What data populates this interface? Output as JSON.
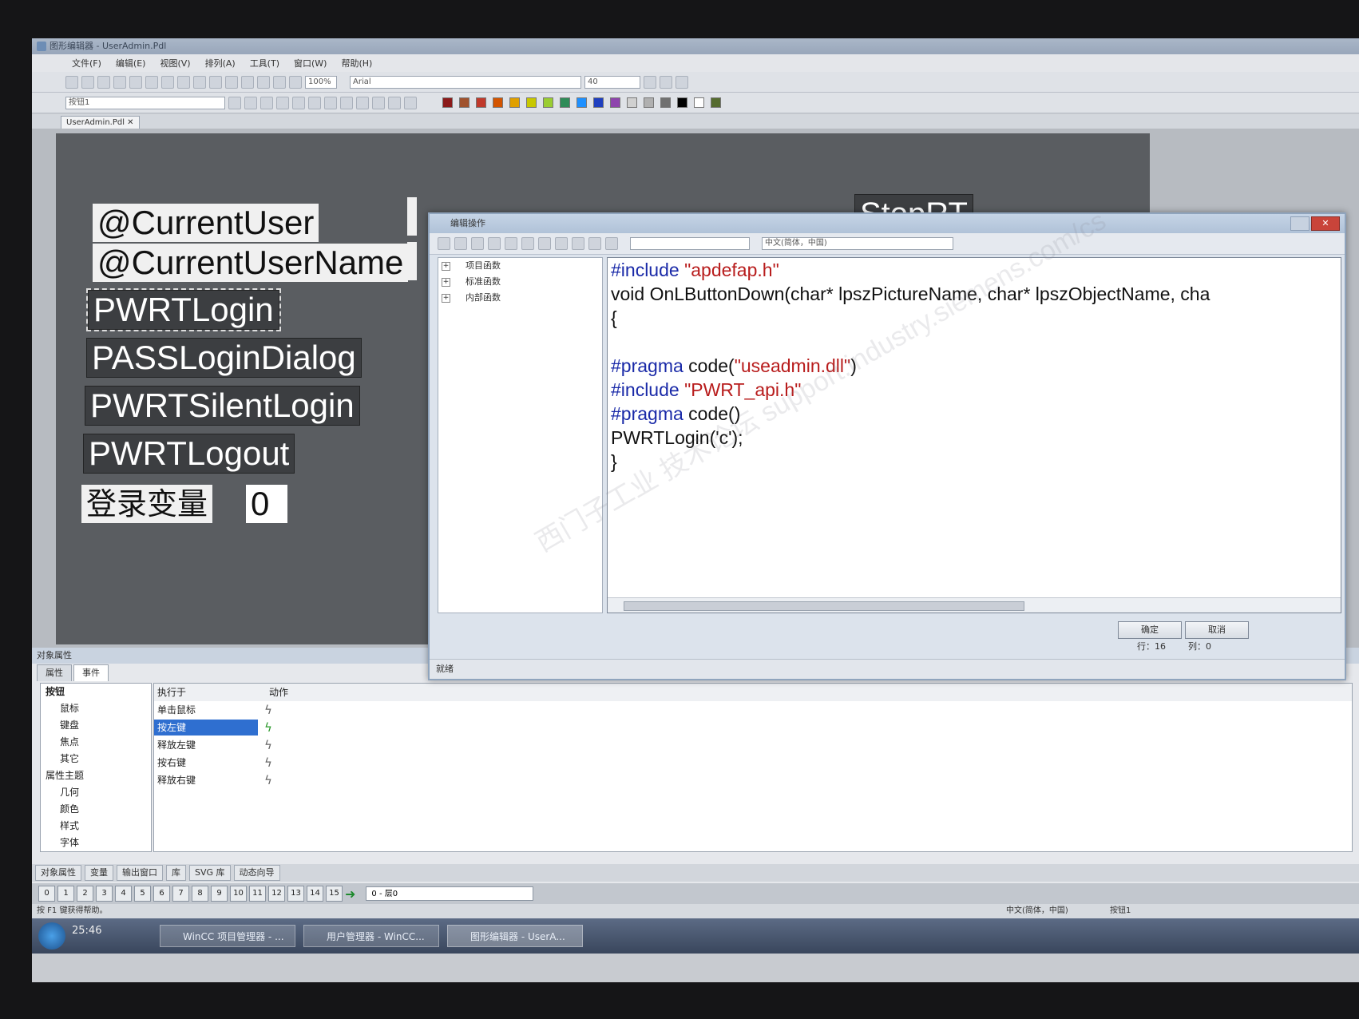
{
  "window": {
    "title": "图形编辑器 - UserAdmin.Pdl"
  },
  "menu": [
    "文件(F)",
    "编辑(E)",
    "视图(V)",
    "排列(A)",
    "工具(T)",
    "窗口(W)",
    "帮助(H)"
  ],
  "toolbar": {
    "zoom": "100%",
    "font": "Arial",
    "font_size": "40",
    "object_combo": "按钮1"
  },
  "colors_palette": [
    "#8b1a1a",
    "#a0522d",
    "#c0392b",
    "#d35400",
    "#e0a000",
    "#c8c800",
    "#9acd32",
    "#2e8b57",
    "#1e90ff",
    "#1f3fbf",
    "#8e44ad",
    "#d0d0d0",
    "#b0b0b0",
    "#707070",
    "#000000",
    "#ffffff",
    "#556b2f"
  ],
  "doc_tab": "UserAdmin.Pdl",
  "canvas_objects": {
    "current_user": "@CurrentUser",
    "current_user_name": "@CurrentUserName",
    "pwrt_login": "PWRTLogin",
    "pass_login_dialog": "PASSLoginDialog",
    "pwrt_silent_login": "PWRTSilentLogin",
    "pwrt_logout": "PWRTLogout",
    "login_var_label": "登录变量",
    "login_var_value": "0",
    "stop_rt": "StopRT"
  },
  "dialog": {
    "title": "编辑操作",
    "lang": "中文(简体，中国)",
    "tree": [
      "项目函数",
      "标准函数",
      "内部函数"
    ],
    "code": {
      "l1_kw": "#include",
      "l1_str": "\"apdefap.h\"",
      "l2": "void OnLButtonDown(char* lpszPictureName, char* lpszObjectName, cha",
      "l3": "{",
      "l5_kw": "#pragma",
      "l5_text": "code(",
      "l5_str": "\"useadmin.dll\"",
      "l5_end": ")",
      "l6_kw": "#include",
      "l6_str": "\"PWRT_api.h\"",
      "l7_kw": "#pragma",
      "l7_text": "code()",
      "l8": "PWRTLogin('c');",
      "l9": "}"
    },
    "ok": "确定",
    "cancel": "取消",
    "status": "就绪",
    "row_label": "行：16",
    "col_label": "列：0"
  },
  "properties": {
    "title": "对象属性",
    "tabs": [
      "属性",
      "事件"
    ],
    "tree": [
      "按钮",
      "鼠标",
      "键盘",
      "焦点",
      "其它",
      "属性主题",
      "几何",
      "颜色",
      "样式",
      "字体"
    ],
    "col_exec": "执行于",
    "col_action": "动作",
    "events": [
      "单击鼠标",
      "按左键",
      "释放左键",
      "按右键",
      "释放右键"
    ],
    "selected_event": "按左键"
  },
  "bottom_tabs": [
    "对象属性",
    "变量",
    "输出窗口",
    "库",
    "SVG 库",
    "动态向导"
  ],
  "layers": [
    "0",
    "1",
    "2",
    "3",
    "4",
    "5",
    "6",
    "7",
    "8",
    "9",
    "10",
    "11",
    "12",
    "13",
    "14",
    "15"
  ],
  "layer_combo": "0 - 层0",
  "statusbar": {
    "hint": "按 F1 键获得帮助。",
    "lang": "中文(简体，中国)",
    "object": "按钮1"
  },
  "taskbar": {
    "time": "25:46",
    "tasks": [
      "WinCC 项目管理器 - ...",
      "用户管理器 - WinCC...",
      "图形编辑器 - UserA..."
    ]
  },
  "watermark": "西门子工业 技术论坛 support.industry.siemens.com/cs"
}
